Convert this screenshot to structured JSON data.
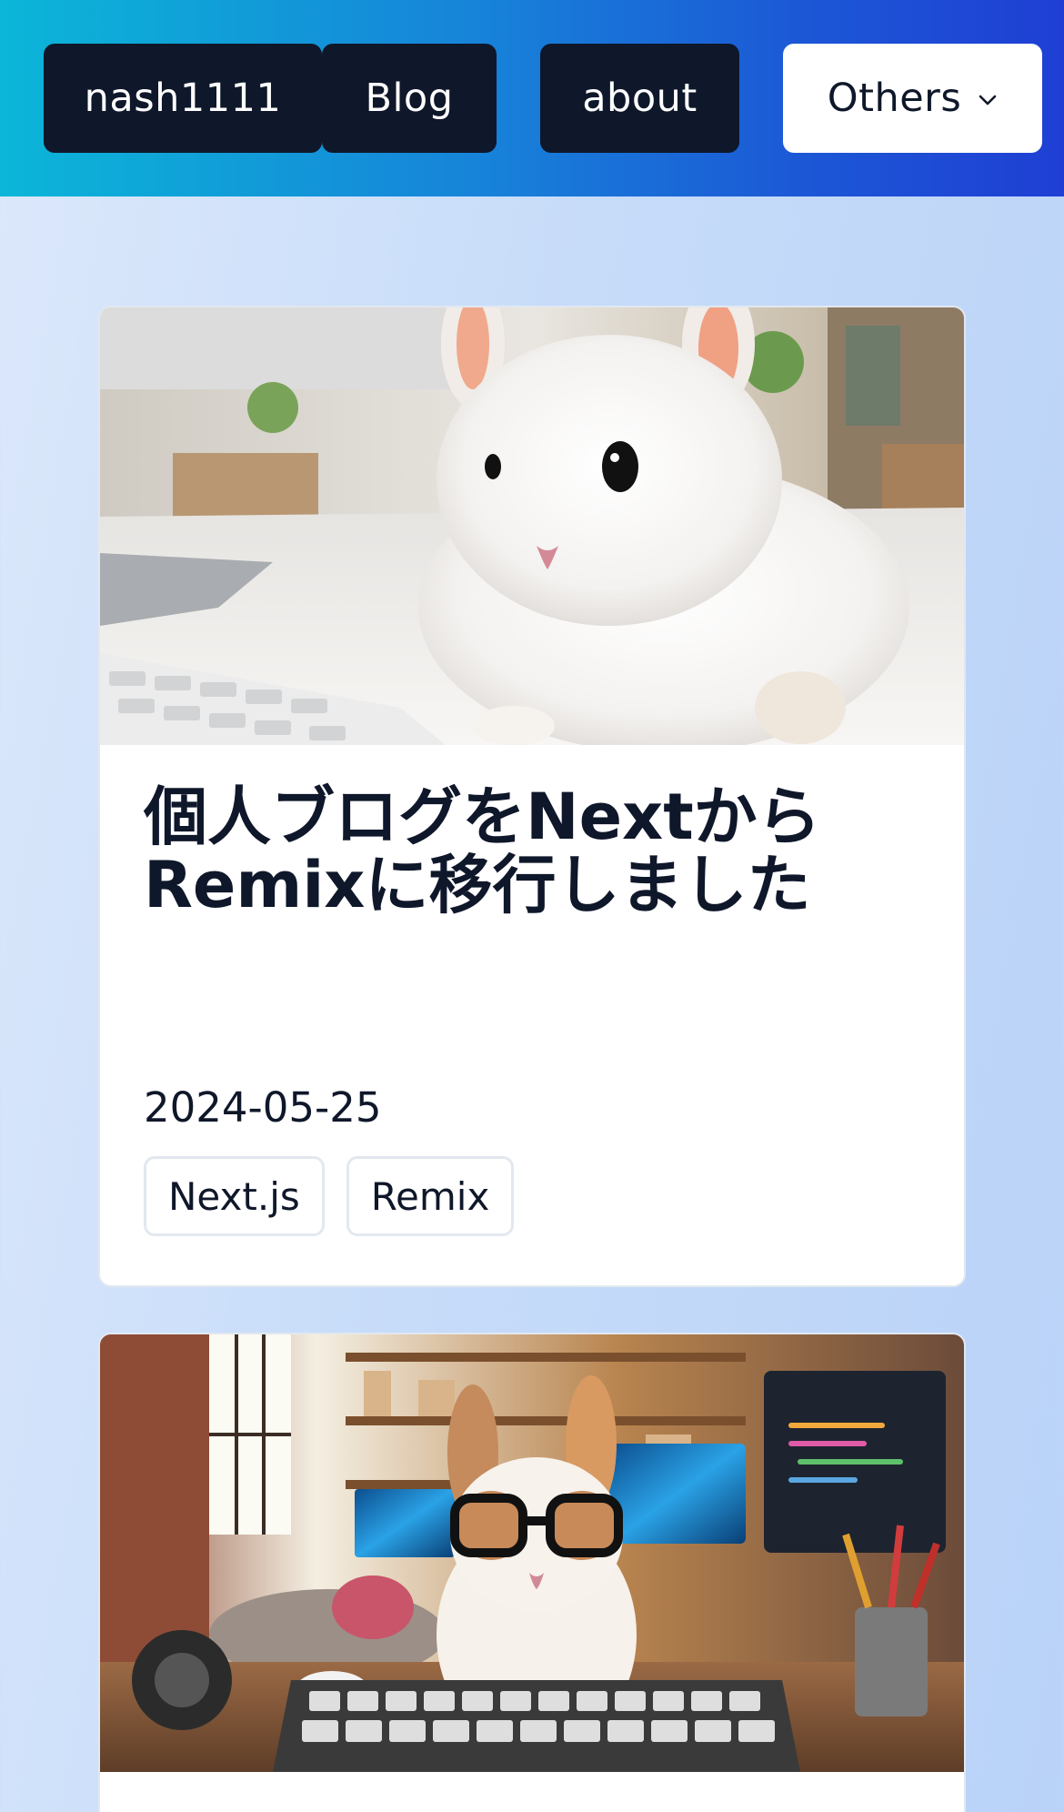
{
  "header": {
    "home_label": "nash1111",
    "blog_label": "Blog",
    "about_label": "about",
    "others_label": "Others"
  },
  "posts": [
    {
      "title": "個人ブログをNextからRemixに移行しました",
      "date": "2024-05-25",
      "tags": [
        "Next.js",
        "Remix"
      ],
      "thumbnail": "white-rabbit-at-keyboard"
    },
    {
      "thumbnail": "rabbit-with-glasses-at-desk"
    }
  ],
  "colors": {
    "nav_dark": "#0f172a",
    "header_start": "#0bb6d8",
    "header_end": "#1f3fd4"
  }
}
